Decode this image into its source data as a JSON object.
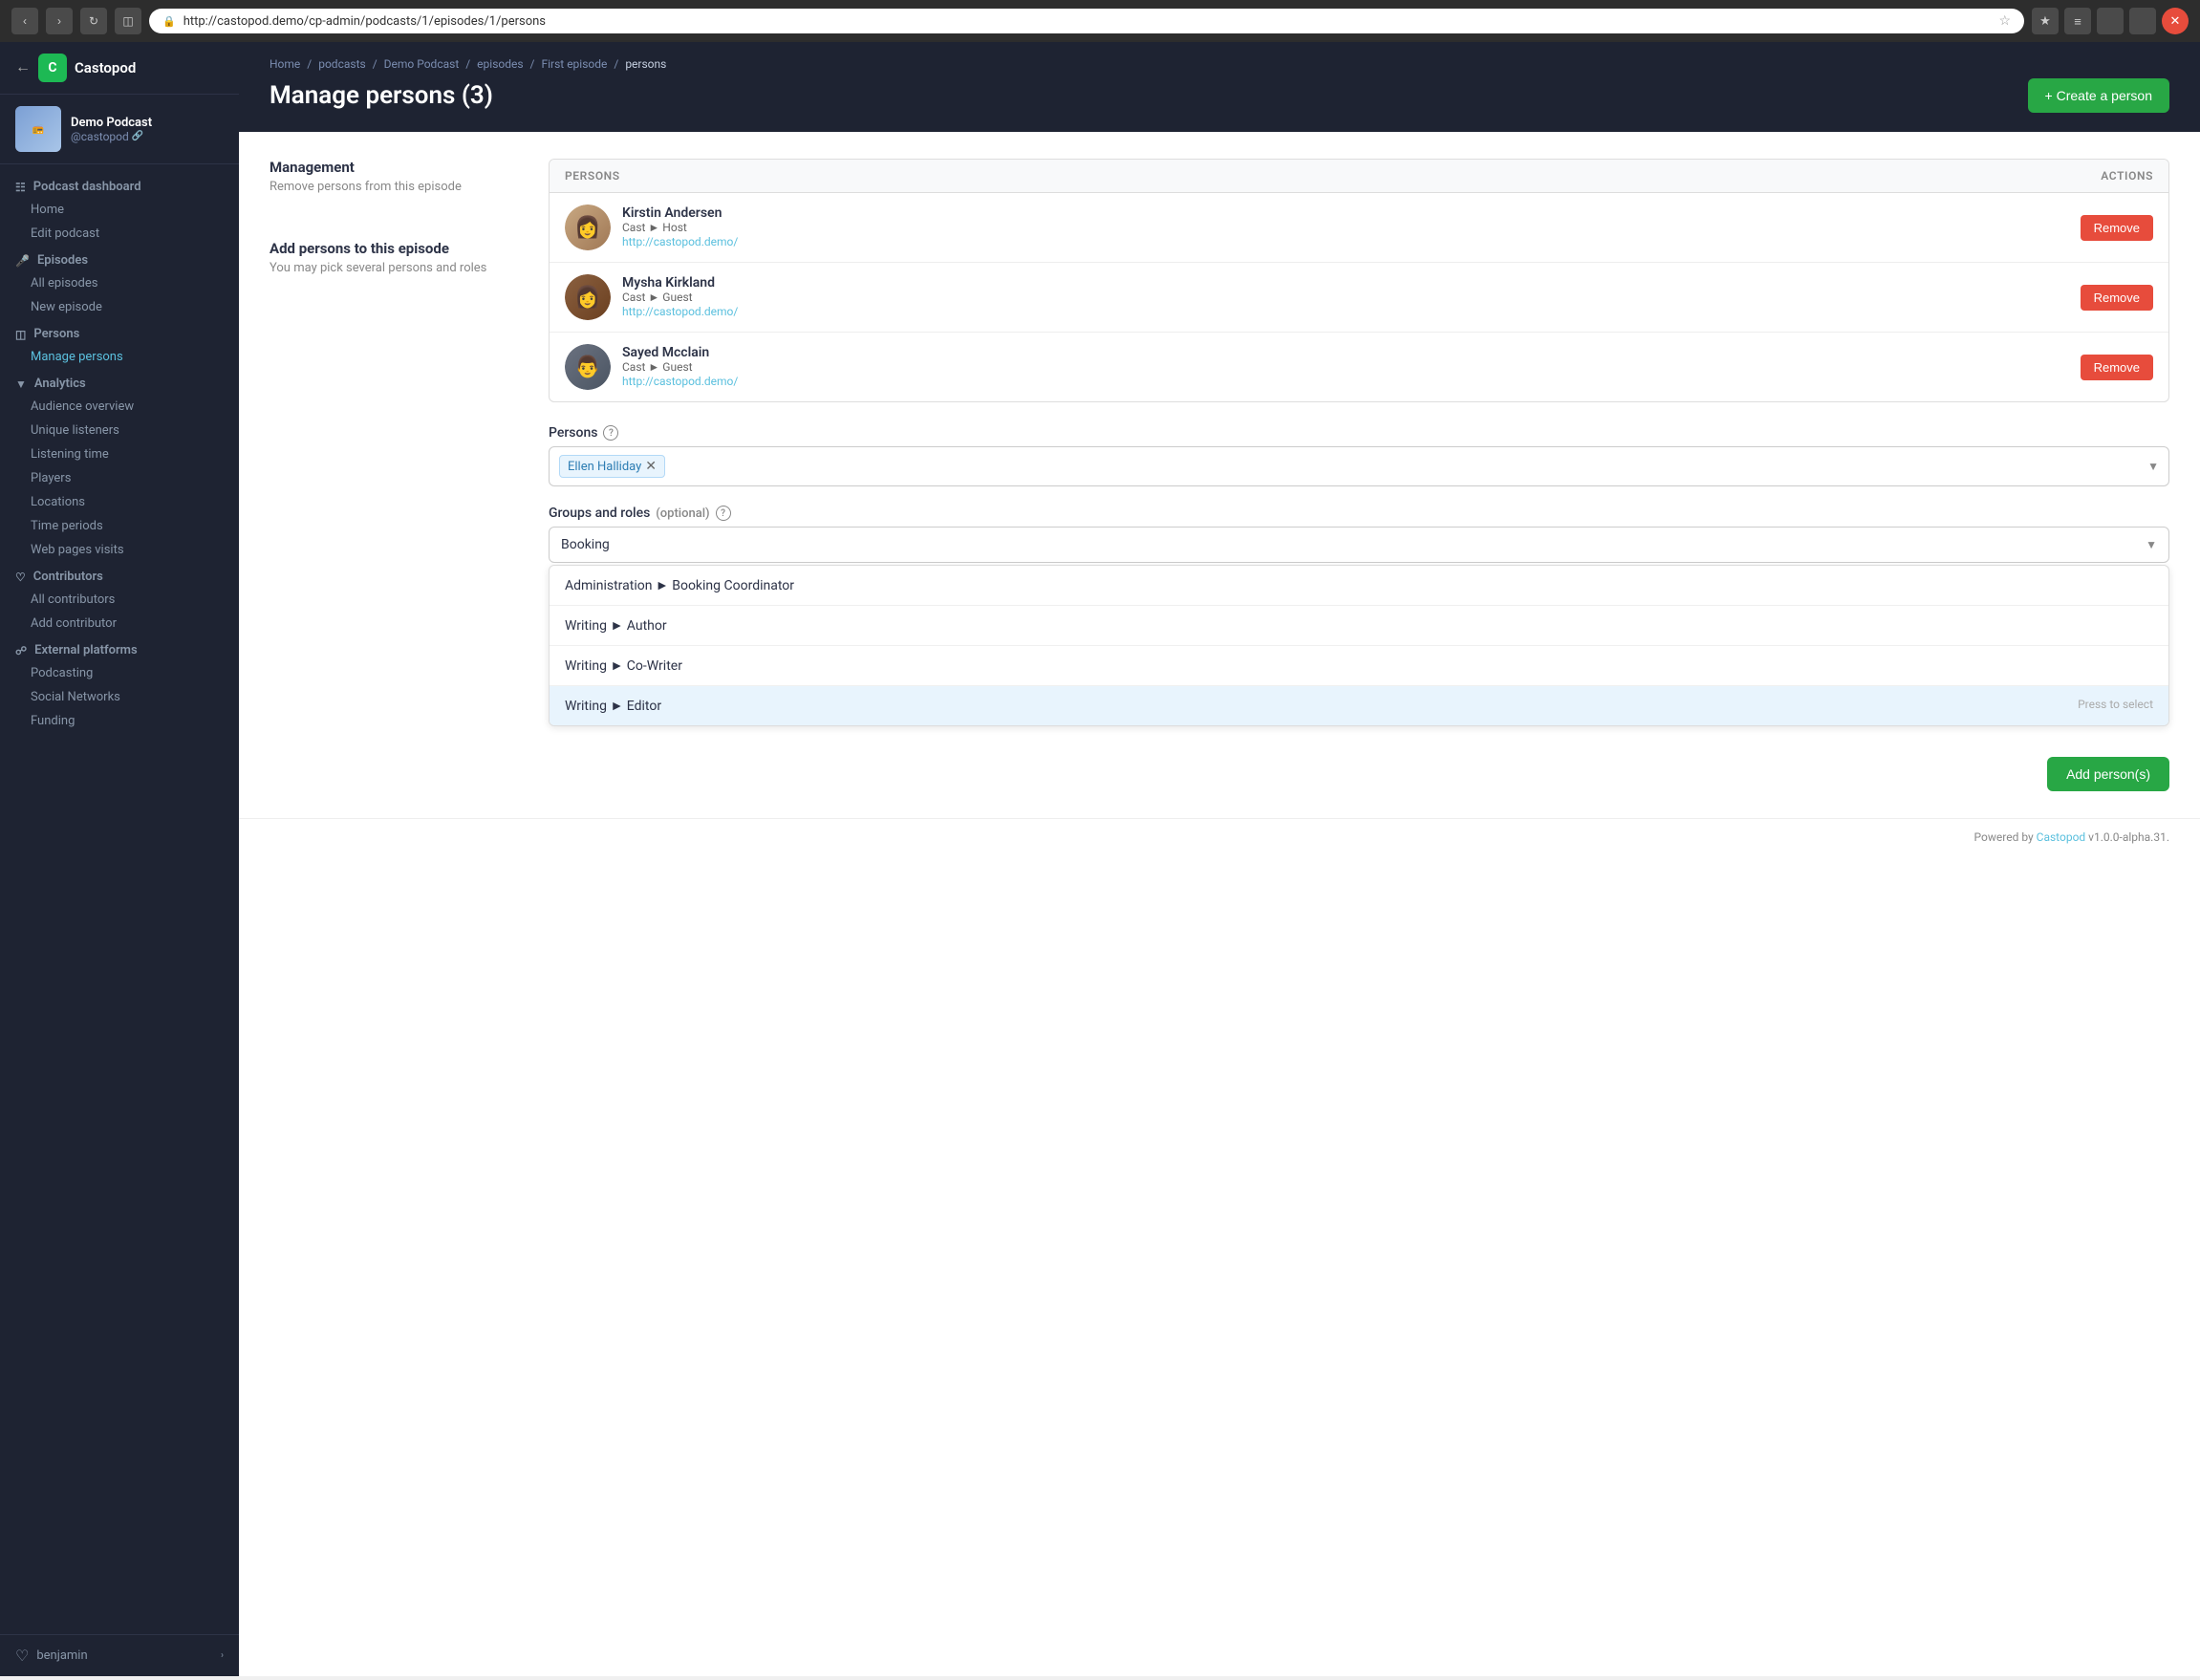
{
  "browser": {
    "url": "http://castopod.demo/cp-admin/podcasts/1/episodes/1/persons",
    "back_title": "Back",
    "forward_title": "Forward",
    "refresh_title": "Refresh",
    "bookmark_title": "Bookmark"
  },
  "sidebar": {
    "app_name": "Castopod",
    "back_label": "←",
    "podcast_name": "Demo Podcast",
    "podcast_handle": "@castopod",
    "sections": {
      "podcast_dashboard": "Podcast dashboard",
      "episodes_label": "Episodes",
      "persons_label": "Persons",
      "analytics_label": "Analytics",
      "contributors_label": "Contributors",
      "external_platforms_label": "External platforms"
    },
    "nav": {
      "home": "Home",
      "edit_podcast": "Edit podcast",
      "all_episodes": "All episodes",
      "new_episode": "New episode",
      "manage_persons": "Manage persons",
      "audience_overview": "Audience overview",
      "unique_listeners": "Unique listeners",
      "listening_time": "Listening time",
      "players": "Players",
      "locations": "Locations",
      "time_periods": "Time periods",
      "web_pages_visits": "Web pages visits",
      "all_contributors": "All contributors",
      "add_contributor": "Add contributor",
      "podcasting": "Podcasting",
      "social_networks": "Social Networks",
      "funding": "Funding"
    },
    "user": {
      "name": "benjamin",
      "chevron": "›"
    }
  },
  "header": {
    "breadcrumb": [
      "Home",
      "podcasts",
      "Demo Podcast",
      "episodes",
      "First episode",
      "persons"
    ],
    "breadcrumb_seps": [
      "/",
      "/",
      "/",
      "/",
      "/"
    ],
    "title": "Manage persons (3)",
    "create_button": "+ Create a person"
  },
  "management": {
    "section_title": "Management",
    "section_desc": "Remove persons from this episode",
    "col_persons": "PERSONS",
    "col_actions": "ACTIONS",
    "persons": [
      {
        "id": "kirstin",
        "name": "Kirstin Andersen",
        "role": "Cast ► Host",
        "link": "http://castopod.demo/",
        "remove_label": "Remove"
      },
      {
        "id": "mysha",
        "name": "Mysha Kirkland",
        "role": "Cast ► Guest",
        "link": "http://castopod.demo/",
        "remove_label": "Remove"
      },
      {
        "id": "sayed",
        "name": "Sayed Mcclain",
        "role": "Cast ► Guest",
        "link": "http://castopod.demo/",
        "remove_label": "Remove"
      }
    ]
  },
  "add_persons": {
    "section_title": "Add persons to this episode",
    "section_desc": "You may pick several persons and roles",
    "persons_label": "Persons",
    "persons_help": "?",
    "selected_person": "Ellen Halliday",
    "groups_label": "Groups and roles",
    "groups_optional": "(optional)",
    "groups_help": "?",
    "dropdown_value": "Booking",
    "dropdown_options": [
      "Administration ► Booking Coordinator",
      "Writing ► Author",
      "Writing ► Co-Writer",
      "Writing ► Editor"
    ],
    "dropdown_active": "Writing ► Editor",
    "press_hint": "Press to select",
    "add_button": "Add person(s)"
  },
  "footer": {
    "powered_by": "Powered by ",
    "castopod_link": "Castopod",
    "version": " v1.0.0-alpha.31."
  }
}
